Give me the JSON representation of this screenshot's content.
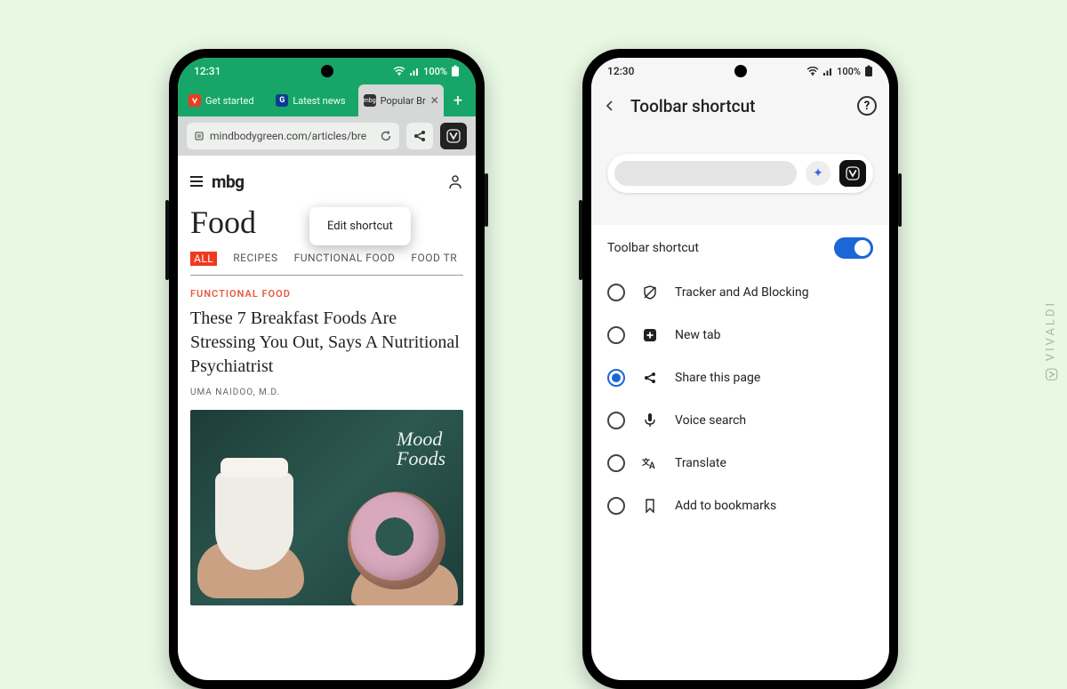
{
  "watermark": "VIVALDI",
  "phoneA": {
    "status": {
      "time": "12:31",
      "battery": "100%"
    },
    "tabs": [
      {
        "label": "Get started"
      },
      {
        "label": "Latest news"
      },
      {
        "label": "Popular Br"
      }
    ],
    "url": "mindbodygreen.com/articles/bre",
    "popover": "Edit shortcut",
    "site": {
      "brand": "mbg",
      "section": "Food",
      "categories": [
        "ALL",
        "RECIPES",
        "FUNCTIONAL FOOD",
        "FOOD TR"
      ],
      "kicker": "FUNCTIONAL FOOD",
      "headline": "These 7 Breakfast Foods Are Stressing You Out, Says A Nutritional Psychiatrist",
      "byline": "UMA NAIDOO, M.D.",
      "image_overlay_line1": "Mood",
      "image_overlay_line2": "Foods"
    }
  },
  "phoneB": {
    "status": {
      "time": "12:30",
      "battery": "100%"
    },
    "title": "Toolbar shortcut",
    "toggle_label": "Toolbar shortcut",
    "toggle_on": true,
    "options": [
      {
        "label": "Tracker and Ad Blocking",
        "selected": false,
        "icon": "shield"
      },
      {
        "label": "New tab",
        "selected": false,
        "icon": "plus"
      },
      {
        "label": "Share this page",
        "selected": true,
        "icon": "share"
      },
      {
        "label": "Voice search",
        "selected": false,
        "icon": "mic"
      },
      {
        "label": "Translate",
        "selected": false,
        "icon": "translate"
      },
      {
        "label": "Add to bookmarks",
        "selected": false,
        "icon": "bookmark"
      }
    ]
  }
}
